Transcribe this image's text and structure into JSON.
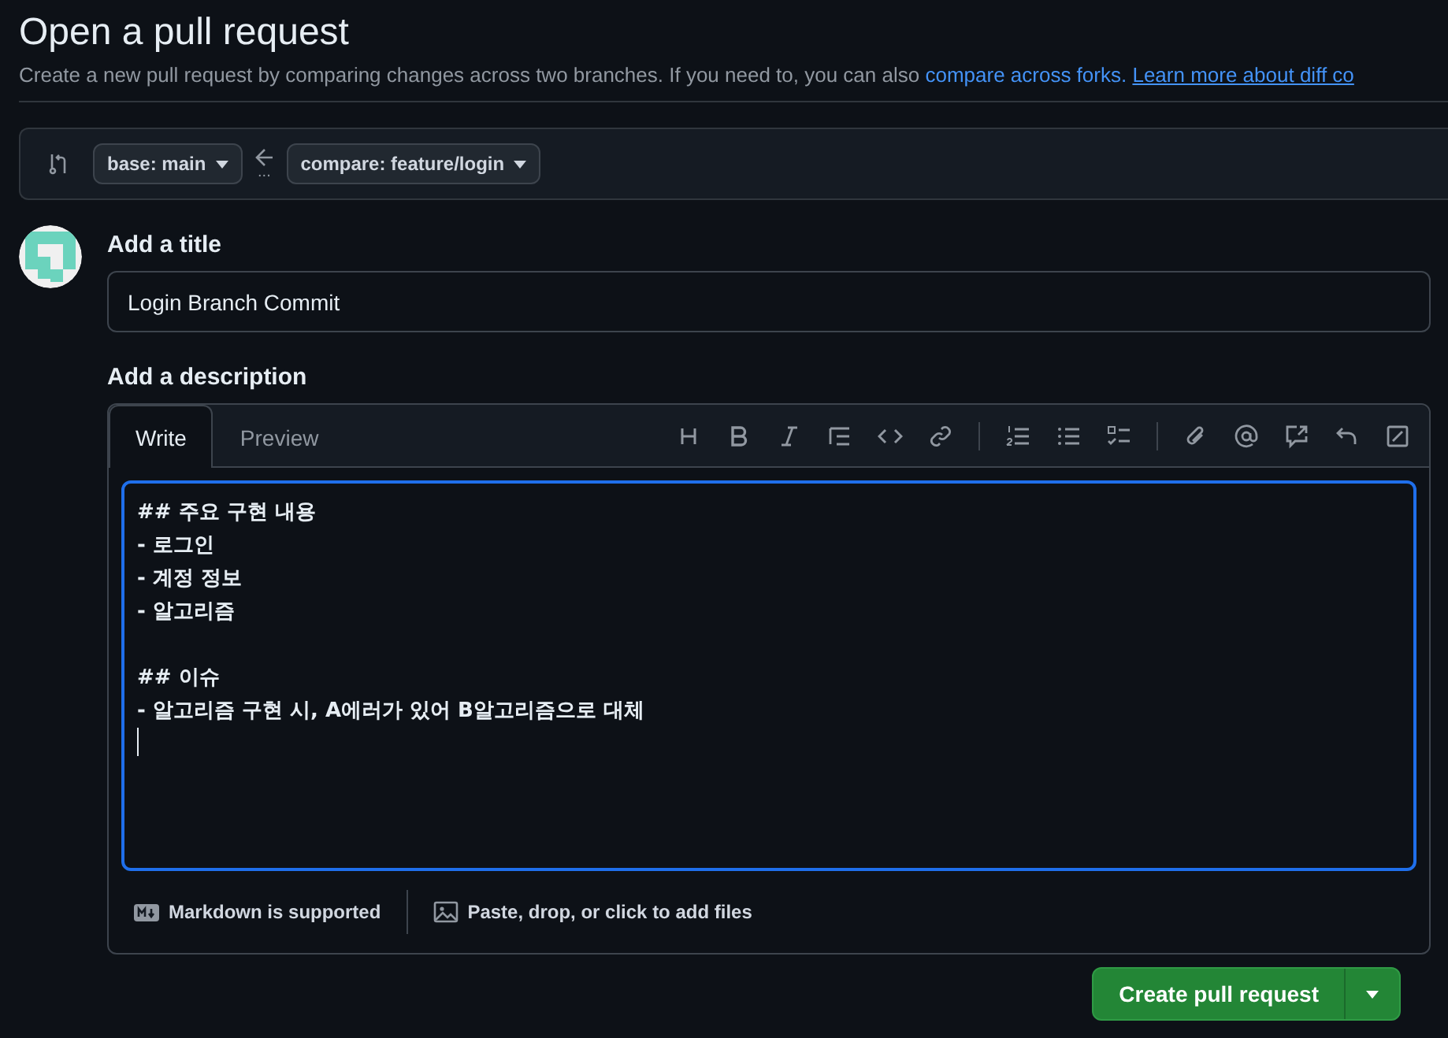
{
  "header": {
    "title": "Open a pull request",
    "subtitle": "Create a new pull request by comparing changes across two branches. If you need to, you can also ",
    "links": [
      "compare across forks.",
      "Learn more about diff co"
    ]
  },
  "branches": {
    "base": "base: main",
    "separator": "...",
    "compare": "compare: feature/login"
  },
  "title_label": "Add a title",
  "title_value": "Login Branch Commit",
  "description_label": "Add a description",
  "tabs": [
    {
      "label": "Write",
      "selected": true
    },
    {
      "label": "Preview",
      "selected": false
    }
  ],
  "body": "## 주요 구현 내용\n- 로그인\n- 계정 정보\n- 알고리즘\n\n## 이슈\n- 알고리즘 구현 시, A에러가 있어 B알고리즘으로 대체",
  "footer": [
    "Markdown is supported",
    "Paste, drop, or click to add files"
  ],
  "submit": "Create pull request"
}
